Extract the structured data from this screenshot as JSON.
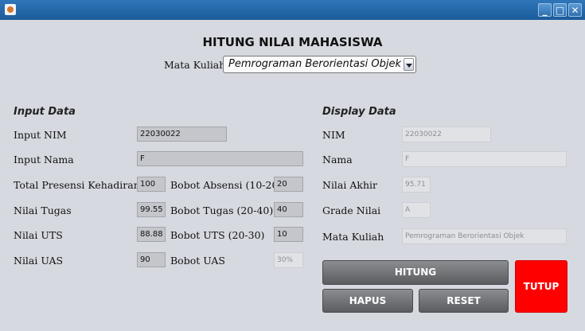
{
  "window": {
    "minimize_icon": "minimize-icon",
    "maximize_icon": "maximize-icon",
    "close_icon": "close-icon"
  },
  "heading": "HITUNG NILAI MAHASISWA",
  "course_select": {
    "label": "Mata Kuliah",
    "value": "Pemrograman Berorientasi Objek"
  },
  "input": {
    "section_title": "Input Data",
    "nim_label": "Input NIM",
    "nim_value": "22030022",
    "nama_label": "Input Nama",
    "nama_value": "F",
    "presensi_label": "Total Presensi Kehadiran",
    "presensi_value": "100",
    "bobot_absensi_label": "Bobot Absensi (10-20)",
    "bobot_absensi_value": "20",
    "tugas_label": "Nilai Tugas",
    "tugas_value": "99.55",
    "bobot_tugas_label": "Bobot Tugas (20-40)",
    "bobot_tugas_value": "40",
    "uts_label": "Nilai UTS",
    "uts_value": "88.88",
    "bobot_uts_label": "Bobot UTS (20-30)",
    "bobot_uts_value": "10",
    "uas_label": "Nilai UAS",
    "uas_value": "90",
    "bobot_uas_label": "Bobot UAS",
    "bobot_uas_value": "30%"
  },
  "display": {
    "section_title": "Display Data",
    "nim_label": "NIM",
    "nim_value": "22030022",
    "nama_label": "Nama",
    "nama_value": "F",
    "nilai_akhir_label": "Nilai Akhir",
    "nilai_akhir_value": "95.71",
    "grade_label": "Grade Nilai",
    "grade_value": "A",
    "mata_kuliah_label": "Mata Kuliah",
    "mata_kuliah_value": "Pemrograman Berorientasi Objek"
  },
  "buttons": {
    "hitung": "HITUNG",
    "hapus": "HAPUS",
    "reset": "RESET",
    "tutup": "TUTUP",
    "tutup_color": "#ff0000"
  }
}
